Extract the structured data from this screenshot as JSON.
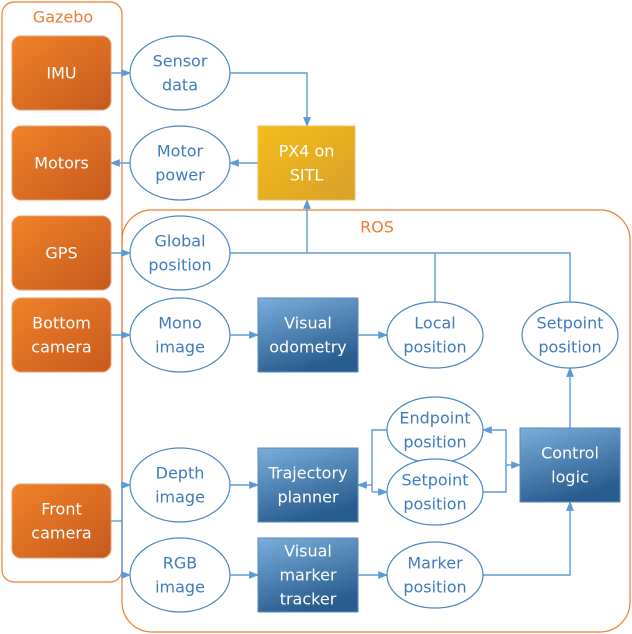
{
  "groups": {
    "gazebo": {
      "label": "Gazebo",
      "color": "#ed7d31"
    },
    "ros": {
      "label": "ROS",
      "color": "#ed7d31"
    }
  },
  "colors": {
    "edge": "#5b9bd5",
    "ellipse_text": "#3f7cbf",
    "gazebo_box": "#d2691e",
    "px4_box": "#e0a820",
    "ros_box": "#2f6597"
  },
  "nodes": {
    "imu": [
      "IMU"
    ],
    "motors": [
      "Motors"
    ],
    "gps": [
      "GPS"
    ],
    "bottom_camera": [
      "Bottom",
      "camera"
    ],
    "front_camera": [
      "Front",
      "camera"
    ],
    "sensor_data": [
      "Sensor",
      "data"
    ],
    "motor_power": [
      "Motor",
      "power"
    ],
    "global_position": [
      "Global",
      "position"
    ],
    "mono_image": [
      "Mono",
      "image"
    ],
    "depth_image": [
      "Depth",
      "image"
    ],
    "rgb_image": [
      "RGB",
      "image"
    ],
    "px4": [
      "PX4 on",
      "SITL"
    ],
    "visual_odometry": [
      "Visual",
      "odometry"
    ],
    "trajectory_planner": [
      "Trajectory",
      "planner"
    ],
    "visual_marker_tracker": [
      "Visual",
      "marker",
      "tracker"
    ],
    "local_position": [
      "Local",
      "position"
    ],
    "setpoint_position_top": [
      "Setpoint",
      "position"
    ],
    "endpoint_position": [
      "Endpoint",
      "position"
    ],
    "setpoint_position": [
      "Setpoint",
      "position"
    ],
    "control_logic": [
      "Control",
      "logic"
    ],
    "marker_position": [
      "Marker",
      "position"
    ]
  }
}
